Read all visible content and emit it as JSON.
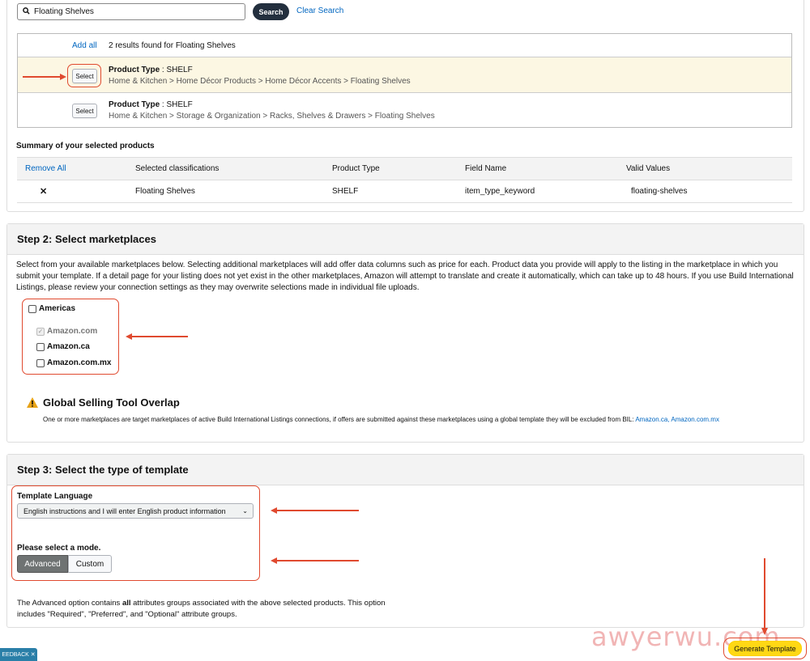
{
  "search": {
    "value": "Floating Shelves",
    "button_label": "Search",
    "clear_label": "Clear Search"
  },
  "results": {
    "add_all_label": "Add all",
    "count_text": "2 results found for Floating Shelves",
    "items": [
      {
        "select_label": "Select",
        "type_label": "Product Type",
        "type_value": " : SHELF",
        "path": "Home & Kitchen > Home Décor Products > Home Décor Accents > Floating Shelves"
      },
      {
        "select_label": "Select",
        "type_label": "Product Type",
        "type_value": " : SHELF",
        "path": "Home & Kitchen > Storage & Organization > Racks, Shelves & Drawers > Floating Shelves"
      }
    ]
  },
  "summary": {
    "title": "Summary of your selected products",
    "headers": [
      "Remove All",
      "Selected classifications",
      "Product Type",
      "Field Name",
      "Valid Values"
    ],
    "row": {
      "remove": "✕",
      "classification": "Floating Shelves",
      "product_type": "SHELF",
      "field_name": "item_type_keyword",
      "valid_values": "floating-shelves"
    }
  },
  "step2": {
    "title": "Step 2: Select marketplaces",
    "description": "Select from your available marketplaces below. Selecting additional marketplaces will add offer data columns such as price for each. Product data you provide will apply to the listing in the marketplace in which you submit your template. If a detail page for your listing does not yet exist in the other marketplaces, Amazon will attempt to translate and create it automatically, which can take up to 48 hours. If you use Build International Listings, please review your connection settings as they may overwrite selections made in individual file uploads.",
    "region": "Americas",
    "marketplaces": [
      "Amazon.com",
      "Amazon.ca",
      "Amazon.com.mx"
    ],
    "warning_title": "Global Selling Tool Overlap",
    "warning_text": "One or more marketplaces are target marketplaces of active Build International Listings connections, if offers are submitted against these marketplaces using a global template they will be excluded from BIL: ",
    "warning_links": "Amazon.ca, Amazon.com.mx"
  },
  "step3": {
    "title": "Step 3: Select the type of template",
    "language_label": "Template Language",
    "language_value": "English instructions and I will enter English product information",
    "mode_label": "Please select a mode.",
    "modes": [
      "Advanced",
      "Custom"
    ],
    "desc_part1": "The Advanced option contains ",
    "desc_bold": "all",
    "desc_part2": " attributes groups associated with the above selected products. This option includes \"Required\", \"Preferred\", and \"Optional\" attribute groups."
  },
  "feedback_label": "EEDBACK ✕",
  "generate_label": "Generate Template",
  "watermark": "awyerwu.com",
  "colors": {
    "accent_red": "#e04a2f",
    "link_blue": "#0066c0",
    "generate_yellow": "#ffd814",
    "feedback_teal": "#2a7fa8"
  }
}
